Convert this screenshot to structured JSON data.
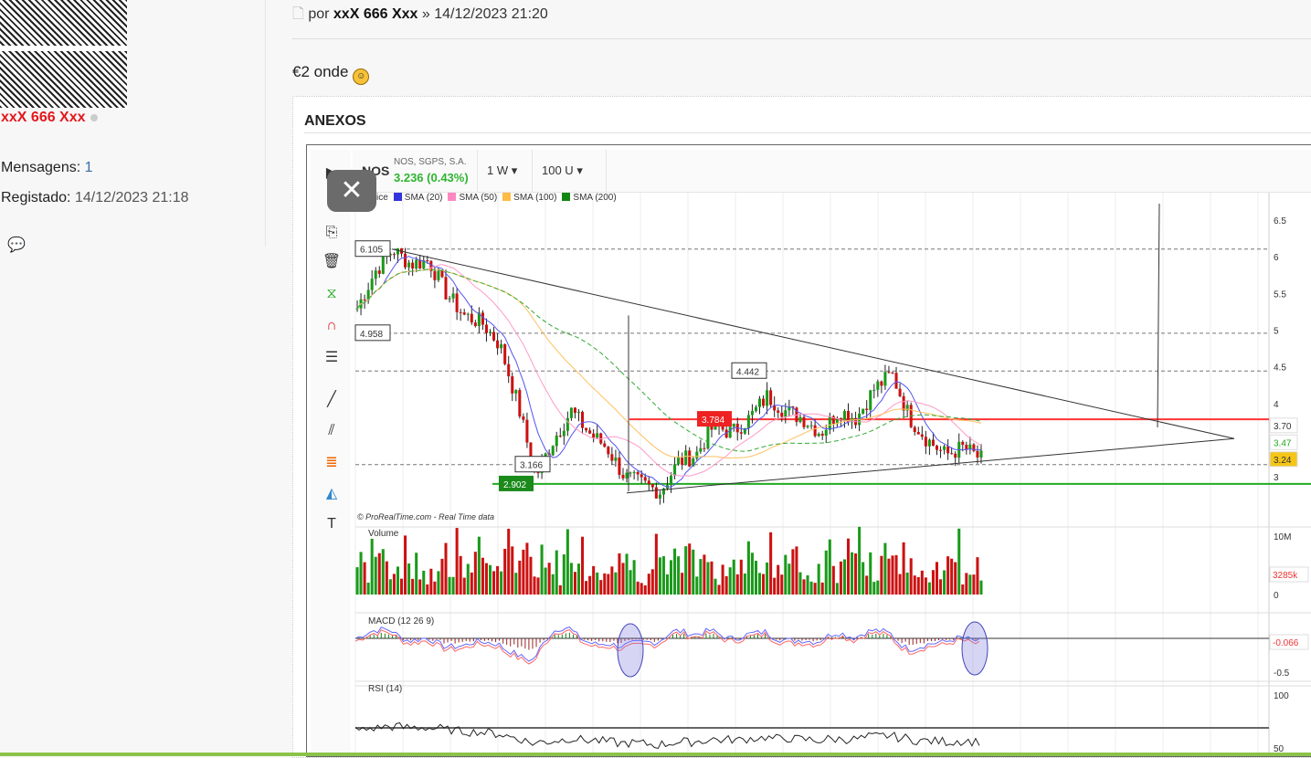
{
  "author": {
    "name": "xxX 666 Xxx",
    "messages_label": "Mensagens:",
    "messages": "1",
    "registered_label": "Registado:",
    "registered": "14/12/2023 21:18"
  },
  "post": {
    "by_label": "por",
    "author": "xxX 666 Xxx",
    "sep": "»",
    "datetime": "14/12/2023 21:20",
    "text": "€2 onde"
  },
  "attachments": {
    "title": "ANEXOS"
  },
  "chart": {
    "symbol": "NOS",
    "company": "NOS, SGPS, S.A.",
    "price": "3.236 (0.43%)",
    "interval": "1 W",
    "units": "100 U",
    "legend": [
      {
        "label": "Price",
        "color": "#000000"
      },
      {
        "label": "SMA (20)",
        "color": "#3333dd"
      },
      {
        "label": "SMA (50)",
        "color": "#ff88c0"
      },
      {
        "label": "SMA (100)",
        "color": "#ffbb44"
      },
      {
        "label": "SMA (200)",
        "color": "#118811"
      }
    ],
    "price_labels": [
      "6.105",
      "4.958",
      "4.442",
      "3.784",
      "3.166",
      "2.902"
    ],
    "axis_ticks": [
      "6.5",
      "6",
      "5.5",
      "5",
      "4.5",
      "4",
      "3"
    ],
    "axis_markers": [
      "3.70",
      "3.47",
      "3.24"
    ],
    "credit": "© ProRealTime.com - Real Time data",
    "volume_label": "Volume",
    "volume_ticks": [
      "10M",
      "0"
    ],
    "volume_last": "3285k",
    "macd_label": "MACD (12 26 9)",
    "macd_last": "-0.066",
    "macd_tick": "-0.5",
    "rsi_label": "RSI (14)",
    "rsi_ticks": [
      "100",
      "50"
    ],
    "series": [
      5.3,
      5.8,
      6.1,
      5.9,
      5.95,
      5.5,
      5.2,
      5.1,
      4.8,
      4.0,
      3.0,
      3.5,
      3.9,
      3.6,
      3.4,
      3.0,
      2.9,
      2.8,
      3.2,
      3.3,
      3.7,
      3.6,
      3.8,
      4.1,
      3.9,
      3.8,
      3.6,
      3.9,
      3.8,
      4.2,
      4.4,
      3.8,
      3.5,
      3.3,
      3.4,
      3.24
    ]
  }
}
